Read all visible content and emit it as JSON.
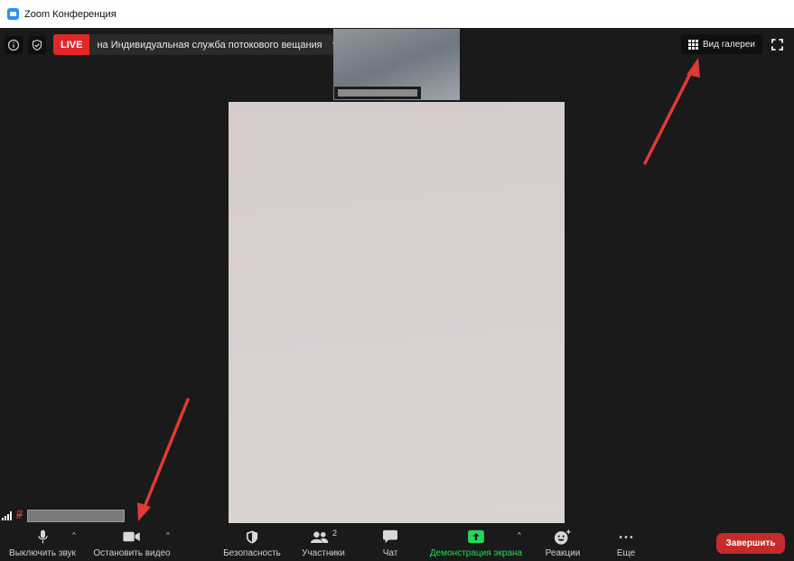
{
  "window": {
    "title": "Zoom Конференция",
    "icon": "zoom-app-icon"
  },
  "top_bar": {
    "info_icon": "info-icon",
    "security_icon": "shield-check-icon",
    "live_badge": "LIVE",
    "live_destination": "на Индивидуальная служба потокового вещания",
    "gallery_view_label": "Вид галереи",
    "fullscreen_icon": "fullscreen-icon"
  },
  "toolbar": {
    "mute": {
      "label": "Выключить звук",
      "icon": "microphone-icon"
    },
    "video": {
      "label": "Остановить видео",
      "icon": "video-camera-icon"
    },
    "security": {
      "label": "Безопасность",
      "icon": "shield-icon"
    },
    "participants": {
      "label": "Участники",
      "count": "2",
      "icon": "participants-icon"
    },
    "chat": {
      "label": "Чат",
      "icon": "chat-icon"
    },
    "share_screen": {
      "label": "Демонстрация экрана",
      "icon": "share-screen-icon"
    },
    "reactions": {
      "label": "Реакции",
      "icon": "emoji-icon"
    },
    "more": {
      "label": "Еще",
      "icon": "more-icon"
    },
    "end_label": "Завершить"
  },
  "colors": {
    "live_red": "#e02828",
    "share_green": "#23d959",
    "end_red": "#c42b2b",
    "annotation_arrow": "#e03a32",
    "background": "#1a1a1a"
  }
}
